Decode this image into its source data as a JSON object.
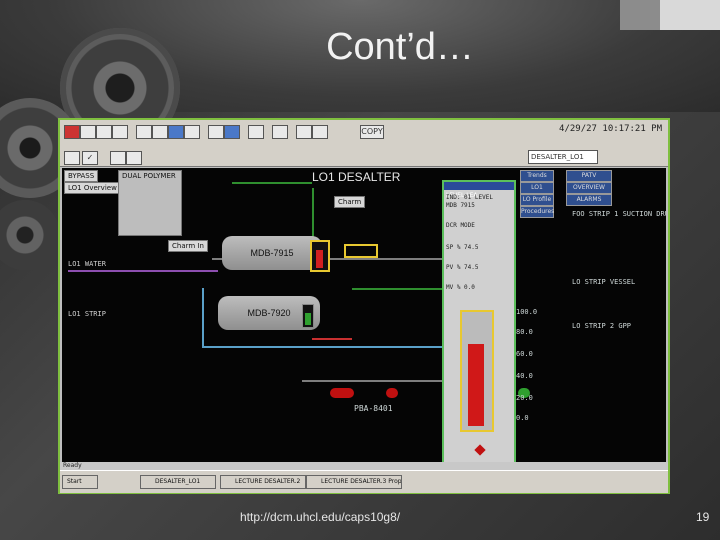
{
  "slide": {
    "title": "Cont’d…",
    "footer_url": "http://dcm.uhcl.edu/caps10g8/",
    "page_number": "19"
  },
  "app": {
    "toolbar": {
      "buttons": [
        "new-icon",
        "open-icon",
        "save-icon",
        "print-icon",
        "cut-icon",
        "copy-icon",
        "paste-icon",
        "undo-icon",
        "zoom-icon",
        "grid-icon",
        "trend-icon",
        "copy-button"
      ],
      "copy_label": "COPY",
      "clock": "4/29/27  10:17:21 PM"
    },
    "address": "DESALTER_LO1",
    "display_title": "LO1 DESALTER",
    "left_panel": {
      "bypass": "BYPASS",
      "overview": "LO1 Overview",
      "mode_title": "DUAL POLYMER"
    },
    "vessels": {
      "upper": "MDB-7915",
      "lower": "MDB-7920"
    },
    "labels": {
      "charm_top": "Charm",
      "charm_left": "Charm In",
      "pump": "PBA-8401",
      "lo1_water": "LO1 WATER",
      "lo1_strip": "LO1 STRIP"
    },
    "popup": {
      "tag": "LEVEL LEA",
      "rows": [
        "IND: 01 LEVEL",
        "MDB 7915",
        "DCR MODE",
        "SP      %   74.5",
        "PV      %   74.5",
        "MV      %   0.0"
      ],
      "scale": [
        "100.0",
        "80.0",
        "60.0",
        "40.0",
        "20.0",
        "0.0"
      ],
      "level_percent": 74.5
    },
    "right_menu": [
      "Trends",
      "PATV",
      "LO1 Levels",
      "OVERVIEW",
      "LO Profile",
      "ALARMS",
      "Procedures"
    ],
    "right_notes": [
      "FOO STRIP 1 SUCTION DRUM",
      "LO STRIP VESSEL",
      "LO STRIP 2 GPP"
    ],
    "statusbar": "Ready",
    "taskbar": [
      "Start",
      "DESALTER_LO1",
      "LECTURE DESALTER.2",
      "LECTURE DESALTER.3 Prop..."
    ]
  }
}
